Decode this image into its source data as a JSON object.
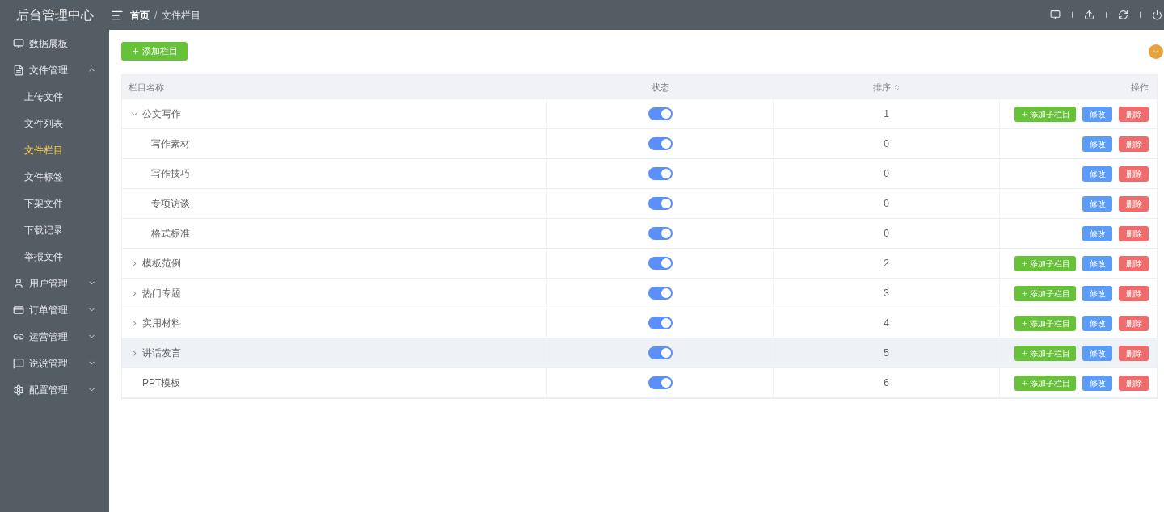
{
  "app_title": "后台管理中心",
  "breadcrumb_separator": "/",
  "breadcrumb": [
    {
      "label": "首页",
      "current": false
    },
    {
      "label": "文件栏目",
      "current": true
    }
  ],
  "sidebar": {
    "items": [
      {
        "kind": "monitor",
        "label": "数据展板"
      },
      {
        "kind": "file",
        "label": "文件管理",
        "expanded": true,
        "children": [
          {
            "label": "上传文件",
            "selected": false
          },
          {
            "label": "文件列表",
            "selected": false
          },
          {
            "label": "文件栏目",
            "selected": true
          },
          {
            "label": "文件标签",
            "selected": false
          },
          {
            "label": "下架文件",
            "selected": false
          },
          {
            "label": "下载记录",
            "selected": false
          },
          {
            "label": "举报文件",
            "selected": false
          }
        ]
      },
      {
        "kind": "user",
        "label": "用户管理",
        "expanded": false
      },
      {
        "kind": "order",
        "label": "订单管理",
        "expanded": false
      },
      {
        "kind": "ops",
        "label": "运营管理",
        "expanded": false
      },
      {
        "kind": "chat",
        "label": "说说管理",
        "expanded": false
      },
      {
        "kind": "gear",
        "label": "配置管理",
        "expanded": false
      }
    ]
  },
  "toolbar": {
    "add_button": "添加栏目"
  },
  "table": {
    "columns": [
      "栏目名称",
      "状态",
      "排序",
      "操作"
    ],
    "rows": [
      {
        "name": "公文写作",
        "on": true,
        "order": "1",
        "expanded": true,
        "hovered": false,
        "actions": [
          {
            "kind": "add",
            "label": "添加子栏目"
          },
          {
            "kind": "edit",
            "label": "修改"
          },
          {
            "kind": "delete",
            "label": "删除"
          }
        ],
        "children": [
          {
            "name": "写作素材",
            "on": true,
            "order": "0",
            "hovered": false,
            "actions": [
              {
                "kind": "edit",
                "label": "修改"
              },
              {
                "kind": "delete",
                "label": "删除"
              }
            ]
          },
          {
            "name": "写作技巧",
            "on": true,
            "order": "0",
            "hovered": false,
            "actions": [
              {
                "kind": "edit",
                "label": "修改"
              },
              {
                "kind": "delete",
                "label": "删除"
              }
            ]
          },
          {
            "name": "专项访谈",
            "on": true,
            "order": "0",
            "hovered": false,
            "actions": [
              {
                "kind": "edit",
                "label": "修改"
              },
              {
                "kind": "delete",
                "label": "删除"
              }
            ]
          },
          {
            "name": "格式标准",
            "on": true,
            "order": "0",
            "hovered": false,
            "actions": [
              {
                "kind": "edit",
                "label": "修改"
              },
              {
                "kind": "delete",
                "label": "删除"
              }
            ]
          }
        ]
      },
      {
        "name": "模板范例",
        "on": true,
        "order": "2",
        "expanded": false,
        "hovered": false,
        "actions": [
          {
            "kind": "add",
            "label": "添加子栏目"
          },
          {
            "kind": "edit",
            "label": "修改"
          },
          {
            "kind": "delete",
            "label": "删除"
          }
        ]
      },
      {
        "name": "热门专题",
        "on": true,
        "order": "3",
        "expanded": false,
        "hovered": false,
        "actions": [
          {
            "kind": "add",
            "label": "添加子栏目"
          },
          {
            "kind": "edit",
            "label": "修改"
          },
          {
            "kind": "delete",
            "label": "删除"
          }
        ]
      },
      {
        "name": "实用材料",
        "on": true,
        "order": "4",
        "expanded": false,
        "hovered": false,
        "actions": [
          {
            "kind": "add",
            "label": "添加子栏目"
          },
          {
            "kind": "edit",
            "label": "修改"
          },
          {
            "kind": "delete",
            "label": "删除"
          }
        ]
      },
      {
        "name": "讲话发言",
        "on": true,
        "order": "5",
        "expanded": false,
        "hovered": true,
        "actions": [
          {
            "kind": "add",
            "label": "添加子栏目"
          },
          {
            "kind": "edit",
            "label": "修改"
          },
          {
            "kind": "delete",
            "label": "删除"
          }
        ]
      },
      {
        "name": "PPT模板",
        "on": true,
        "order": "6",
        "hovered": false,
        "actions": [
          {
            "kind": "add",
            "label": "添加子栏目"
          },
          {
            "kind": "edit",
            "label": "修改"
          },
          {
            "kind": "delete",
            "label": "删除"
          }
        ]
      }
    ]
  }
}
